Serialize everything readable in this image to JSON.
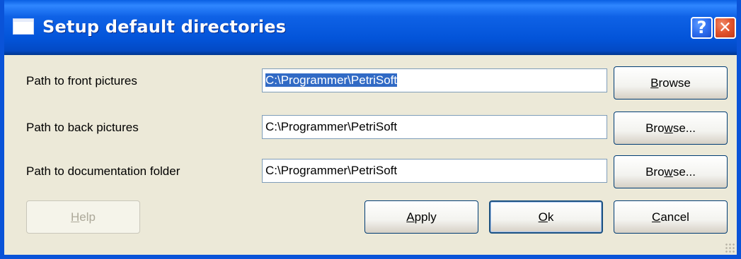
{
  "window": {
    "title": "Setup default directories"
  },
  "titlebar_buttons": {
    "help_glyph": "?",
    "close_glyph": "✕"
  },
  "rows": [
    {
      "label": "Path to front pictures",
      "path": "C:\\Programmer\\PetriSoft",
      "path_selected": true,
      "browse": {
        "pre": "",
        "mnemonic": "B",
        "post": "rowse"
      }
    },
    {
      "label": "Path to back pictures",
      "path": "C:\\Programmer\\PetriSoft",
      "path_selected": false,
      "browse": {
        "pre": "Bro",
        "mnemonic": "w",
        "post": "se..."
      }
    },
    {
      "label": "Path to documentation folder",
      "path": "C:\\Programmer\\PetriSoft",
      "path_selected": false,
      "browse": {
        "pre": "Bro",
        "mnemonic": "w",
        "post": "se..."
      }
    }
  ],
  "footer": {
    "help": {
      "mnemonic": "H",
      "post": "elp",
      "enabled": false
    },
    "apply": {
      "mnemonic": "A",
      "post": "pply"
    },
    "ok": {
      "mnemonic": "O",
      "post": "k"
    },
    "cancel": {
      "mnemonic": "C",
      "post": "ancel"
    }
  },
  "colors": {
    "titlebar": "#0354d9",
    "face": "#ece9d8",
    "selection": "#316ac5"
  }
}
